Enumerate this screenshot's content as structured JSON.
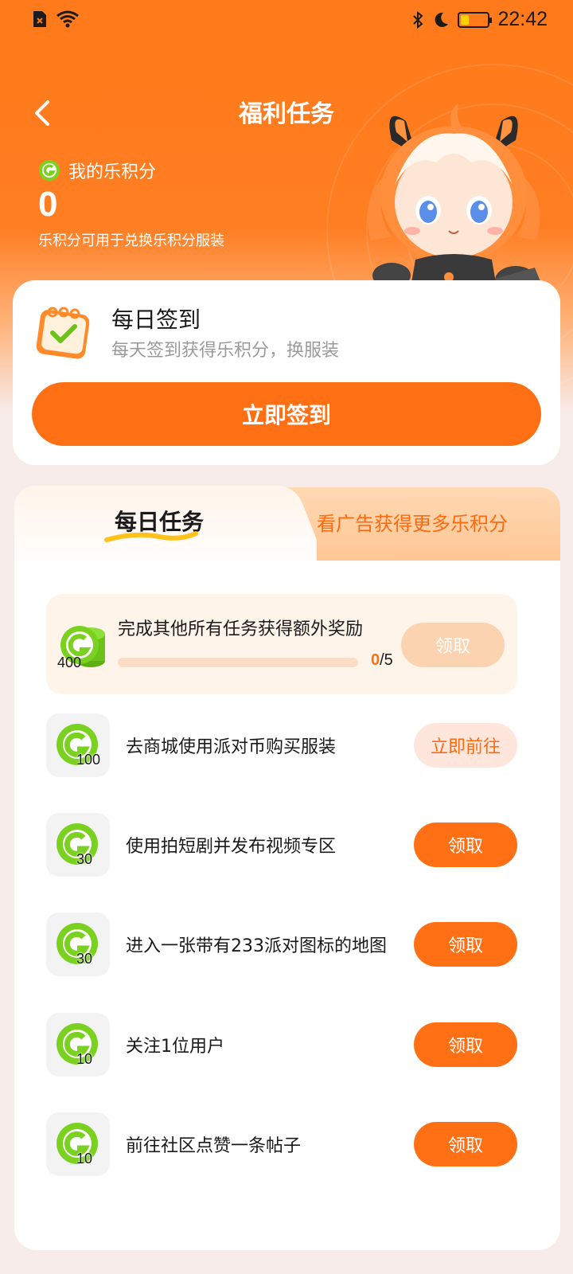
{
  "status_bar": {
    "time": "22:42"
  },
  "header": {
    "title": "福利任务"
  },
  "points": {
    "label": "我的乐积分",
    "value": "0",
    "description": "乐积分可用于兑换乐积分服装"
  },
  "sign_in": {
    "title": "每日签到",
    "subtitle": "每天签到获得乐积分，换服装",
    "button": "立即签到"
  },
  "tabs": [
    {
      "label": "每日任务",
      "active": true
    },
    {
      "label": "看广告获得更多乐积分",
      "active": false
    }
  ],
  "bonus_task": {
    "amount": "400",
    "title": "完成其他所有任务获得额外奖励",
    "progress_current": "0",
    "progress_total": "/5",
    "progress_fraction": 0,
    "button": "领取"
  },
  "tasks": [
    {
      "amount": "100",
      "text": "去商城使用派对币购买服装",
      "button": "立即前往",
      "style": "soft"
    },
    {
      "amount": "30",
      "text": "使用拍短剧并发布视频专区",
      "button": "领取",
      "style": "solid"
    },
    {
      "amount": "30",
      "text": "进入一张带有233派对图标的地图",
      "button": "领取",
      "style": "solid"
    },
    {
      "amount": "10",
      "text": "关注1位用户",
      "button": "领取",
      "style": "solid"
    },
    {
      "amount": "10",
      "text": "前往社区点赞一条帖子",
      "button": "领取",
      "style": "solid"
    }
  ],
  "colors": {
    "accent": "#ff7014",
    "header_bg": "#ff7a1a",
    "coin_green": "#7ad11f",
    "page_bg": "#f7ecea"
  },
  "icons": {
    "status_left": [
      "sim-icon",
      "wifi-icon"
    ],
    "status_right": [
      "bluetooth-icon",
      "moon-icon",
      "battery-icon"
    ],
    "back": "back-arrow-icon",
    "coin": "g-coin-icon",
    "calendar": "calendar-check-icon",
    "collapse": "chevron-up-icon"
  }
}
